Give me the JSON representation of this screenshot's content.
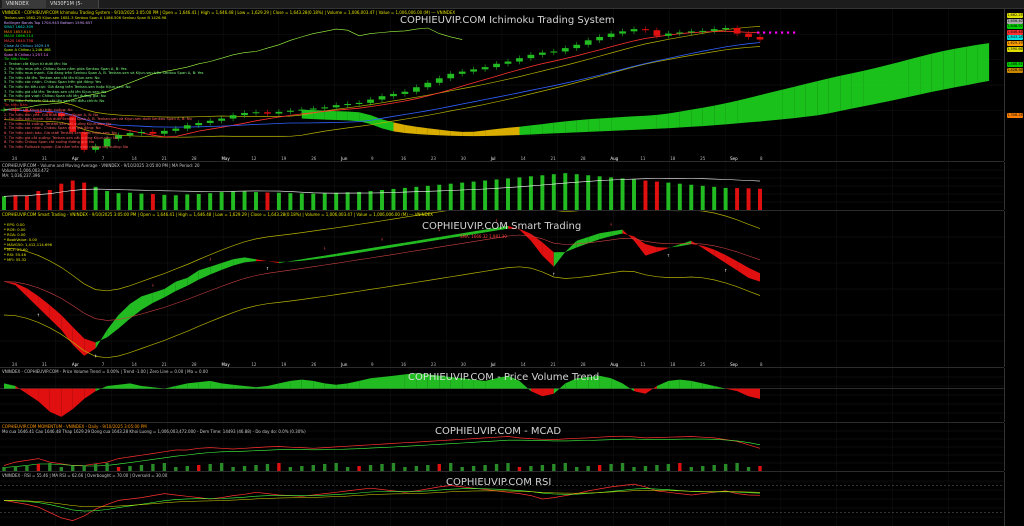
{
  "tabs": [
    "VNINDEX (Daily)",
    "VN30F1M (5-minute)"
  ],
  "panels": {
    "ichimoku": {
      "title": "COPHIEUVIP.COM Ichimoku Trading System",
      "header": "VNINDEX - COPHIEUVIP.COM Ichimoku Trading System - 9/10/2025 3:05:00 PM | Open = 1,646.41 | High = 1,646.48 | Low = 1,629.29 | Close = 1,643.28(0.18%) | Volume = 1,006,003.47 | Value = 1,006,006.00 (M) --- VNINDEX",
      "info_lines": [
        "Tenkan-sen 1662.25  Kijun-sen 1681.3  Senkou Span A 1486.506  Senkou Span B 1426.98",
        "Bollinger Bands Top 1704.943  Bottom 1590.657",
        "SMA7 1662.309",
        "MA5 1653.614",
        "MA10 1666.314",
        "MA20 1640.758",
        "Close At Chikou 1629.19",
        "Span A Chikou 1,246.468",
        "Span B Chikou 1,257.14",
        "Tin hiệu Mua:",
        "1. Tenkan cắt Kijun từ dưới lên: No",
        "2. Tín hiệu mua yếu. Chikou Span nằm giữa Senkou Span A, B: Yes",
        "3. Tín hiệu mua mạnh. Giá đang trên Senkou Span A, B. Tenkan-sen và Kijun-sen trên Senkou Span A, B: Yes",
        "4. Tín hiệu cắt lên. Tenkan-sen cắt lên Kijun-sen: No",
        "5. Tín hiệu xác nhận. Chikou Span trên giá đóng: Yes",
        "6. Tín hiệu tín tiêu cực: Giá đang trên Tenkan-sen hoặc Kijun-sen: No",
        "7. Tín hiệu giá cắt lên: Tenkan-sen cắt lên Kijun-sen: No",
        "8. Tín hiệu giá vượt: Chikou Span cắt lên đường giá: No",
        "9. Tín hiệu Pullback: Giá cắt lên sau khi điều chỉnh: No",
        "Tin hiệu Bán:",
        "1. Tenkan cắt Kijun từ trên xuống: No",
        "2. Tín hiệu bán yếu. Giá dưới Senkou Span A, B: No",
        "3. Tín hiệu bán mạnh. Giá dưới Senkou Span A, B. Tenkan-sen và Kijun-sen dưới Senkou Span A, B: No",
        "4. Tín hiệu cắt xuống. Tenkan-sen cắt xuống Kijun-sen: No",
        "5. Tín hiệu xác nhận. Chikou Span dưới giá đóng: No",
        "6. Tín hiệu cảnh báo. Giá dưới Tenkan-sen hoặc Kijun-sen: No",
        "7. Tín hiệu giá cắt xuống: Tenkan-sen cắt xuống Kijun-sen: No",
        "8. Tín hiệu Chikou Span cắt xuống đường giá: No",
        "9. Tín hiệu Pullback ngược: Giá nằm trên mây nhưng cắt xuống: No"
      ]
    },
    "volume": {
      "header": "COPHIEUVIP.COM - Volume and Moving Average - VNINDEX - 9/10/2025 3:05:00 PM | MA Period: 20",
      "line2": "Volume: 1,006,003.472",
      "line3": "MA: 1,036,237.396"
    },
    "smart": {
      "title": "COPHIEUVIP.COM Smart Trading",
      "header": "COPHIEUVIP.COM Smart Trading - VNINDEX - 9/10/2025 3:05:00 PM | Open = 1,646.41 | High = 1,646.48 | Low = 1,629.29 | Close = 1,643.28(0.18%) | Volume = 1,006,003.47 | Value = 1,006,006.00 (M) --- VNINDEX",
      "info_lines": [
        "* EPS: 0.00",
        "* ROE: 0.00",
        "* ROA: 0.00",
        "* BookValue: 0.00",
        "* MAVG50: 1,412,114.696",
        "* MCF: 23.60",
        "* RSI: 55.46",
        "* MFI: 55.32"
      ],
      "mid_label": "SMA: 1666.32 1,981.30"
    },
    "pvt": {
      "title": "COPHIEUVIP.COM - Price Volume Trend",
      "header": "VNINDEX - COPHIEUVIP.COM - Price Volume Trend = 0.00% | Trend -1.00 | Zero Line = 0.00 | Ma = 0.00"
    },
    "macd": {
      "title": "COPHIEUVIP.COM - MCAD",
      "header": "COPHIEUVIP.COM MOMENTUM - VNINDEX - Daily - 9/10/2025 3:05:00 PM",
      "line2": "Mo cua 1646.41  Cao 1646.48  Thap 1629.29  Dong cua 1643.28  Khoi Luong = 1,006,003,472.000 - Dem Time: 14493 (46.88) - Do day do: 0.0% (0.30%)"
    },
    "rsi": {
      "title": "COPHIEUVIP.COM RSI",
      "header": "VNINDEX - RSI = 55.46 | MA RSI = 62.66 | Overbought = 70.00 | Oversold = 30.00"
    }
  },
  "x_axis_labels": [
    "24",
    "31",
    "Apr",
    "7",
    "14",
    "21",
    "28",
    "May",
    "12",
    "19",
    "26",
    "Jun",
    "9",
    "16",
    "23",
    "30",
    "Jul",
    "14",
    "21",
    "28",
    "Aug",
    "11",
    "18",
    "25",
    "Sep",
    "8"
  ],
  "price_axis_tags": [
    "1,662.25",
    "1,656.40",
    "1,648.92",
    "1,646.48",
    "1,643.28",
    "1,629.29",
    "1,590.66",
    "1,486.51",
    "1,426.98",
    "1,356.28"
  ],
  "chart_data": [
    {
      "type": "candlestick",
      "title": "COPHIEUVIP.COM Ichimoku Trading System",
      "x_start": "2025-03-24",
      "x_end": "2025-09-10",
      "close": [
        1330,
        1325,
        1320,
        1318,
        1315,
        1300,
        1230,
        1150,
        1165,
        1200,
        1215,
        1225,
        1230,
        1222,
        1235,
        1245,
        1260,
        1270,
        1280,
        1290,
        1305,
        1315,
        1318,
        1312,
        1320,
        1325,
        1330,
        1335,
        1340,
        1350,
        1355,
        1360,
        1375,
        1390,
        1400,
        1410,
        1430,
        1450,
        1470,
        1490,
        1500,
        1510,
        1520,
        1535,
        1545,
        1560,
        1575,
        1585,
        1590,
        1605,
        1620,
        1640,
        1655,
        1670,
        1680,
        1690,
        1685,
        1660,
        1670,
        1675,
        1680,
        1682,
        1690,
        1695,
        1670,
        1655,
        1643.28
      ],
      "ylim": [
        1100,
        1780
      ],
      "last": {
        "open": 1646.41,
        "high": 1646.48,
        "low": 1629.29,
        "close": 1643.28,
        "change_pct": 0.18,
        "volume": 1006003.47
      }
    },
    {
      "type": "bar",
      "title": "Volume and Moving Average",
      "values": [
        650,
        700,
        680,
        900,
        950,
        1250,
        1400,
        1300,
        1100,
        900,
        800,
        820,
        780,
        760,
        720,
        700,
        740,
        760,
        800,
        850,
        870,
        880,
        850,
        830,
        820,
        800,
        790,
        780,
        800,
        820,
        840,
        860,
        900,
        950,
        1000,
        1050,
        1100,
        1150,
        1200,
        1250,
        1300,
        1350,
        1400,
        1450,
        1500,
        1550,
        1600,
        1650,
        1700,
        1750,
        1700,
        1650,
        1600,
        1550,
        1500,
        1450,
        1400,
        1350,
        1300,
        1250,
        1200,
        1150,
        1100,
        1050,
        1040,
        1030,
        1006
      ],
      "ma_period": 20
    },
    {
      "type": "area",
      "title": "COPHIEUVIP.COM Smart Trading",
      "values": [
        0.1,
        0.0,
        -0.3,
        -0.6,
        -0.9,
        -1.2,
        -1.6,
        -1.9,
        -1.7,
        -1.2,
        -0.8,
        -0.5,
        -0.3,
        -0.2,
        -0.1,
        0.1,
        0.2,
        0.4,
        0.5,
        0.6,
        0.7,
        0.75,
        0.7,
        0.65,
        0.6,
        0.65,
        0.7,
        0.75,
        0.8,
        0.85,
        0.9,
        0.95,
        1.0,
        1.05,
        1.1,
        1.15,
        1.2,
        1.25,
        1.3,
        1.35,
        1.4,
        1.45,
        1.5,
        1.55,
        1.6,
        1.5,
        1.2,
        0.8,
        0.5,
        0.9,
        1.2,
        1.3,
        1.4,
        1.45,
        1.5,
        1.2,
        0.8,
        0.9,
        1.0,
        1.1,
        1.2,
        1.0,
        0.8,
        0.6,
        0.4,
        0.2,
        0.1
      ],
      "ylim": [
        -2.2,
        2.0
      ]
    },
    {
      "type": "area",
      "title": "COPHIEUVIP.COM - Price Volume Trend",
      "values": [
        0.2,
        0.1,
        -0.2,
        -0.5,
        -0.9,
        -1.1,
        -0.8,
        -0.4,
        -0.1,
        0.1,
        0.15,
        0.2,
        0.1,
        0.05,
        0.0,
        0.1,
        0.2,
        0.25,
        0.3,
        0.2,
        0.15,
        0.1,
        0.05,
        0.1,
        0.2,
        0.3,
        0.35,
        0.3,
        0.2,
        0.15,
        0.2,
        0.3,
        0.4,
        0.45,
        0.5,
        0.55,
        0.6,
        0.55,
        0.5,
        0.45,
        0.4,
        0.35,
        0.3,
        0.4,
        0.5,
        0.3,
        -0.1,
        -0.3,
        -0.2,
        0.2,
        0.4,
        0.45,
        0.5,
        0.4,
        0.2,
        -0.1,
        -0.2,
        0.1,
        0.3,
        0.35,
        0.3,
        0.2,
        0.1,
        0.0,
        -0.1,
        -0.3,
        -0.4
      ],
      "ylim": [
        -1.3,
        0.8
      ]
    },
    {
      "type": "line",
      "title": "COPHIEUVIP.COM - MCAD",
      "values": [
        0.1,
        0.2,
        0.25,
        0.3,
        0.2,
        0.15,
        0.1,
        0.1,
        0.15,
        0.2,
        0.3,
        0.35,
        0.4,
        0.45,
        0.5,
        0.55,
        0.55,
        0.6,
        0.62,
        0.6,
        0.58,
        0.6,
        0.62,
        0.64,
        0.65,
        0.63,
        0.62,
        0.6,
        0.62,
        0.64,
        0.66,
        0.68,
        0.7,
        0.72,
        0.74,
        0.76,
        0.78,
        0.8,
        0.82,
        0.84,
        0.86,
        0.88,
        0.9,
        0.92,
        0.94,
        0.9,
        0.88,
        0.86,
        0.85,
        0.87,
        0.89,
        0.9,
        0.92,
        0.94,
        0.95,
        0.93,
        0.9,
        0.91,
        0.92,
        0.93,
        0.94,
        0.92,
        0.9,
        0.85,
        0.8,
        0.7,
        0.6
      ],
      "ylim": [
        0,
        1.1
      ]
    },
    {
      "type": "line",
      "title": "COPHIEUVIP.COM RSI",
      "values": [
        48,
        45,
        42,
        38,
        30,
        22,
        18,
        25,
        35,
        42,
        48,
        50,
        52,
        55,
        58,
        56,
        54,
        52,
        50,
        52,
        55,
        57,
        60,
        58,
        56,
        55,
        54,
        56,
        58,
        60,
        62,
        64,
        66,
        64,
        62,
        60,
        62,
        65,
        68,
        70,
        68,
        66,
        64,
        62,
        60,
        58,
        55,
        50,
        52,
        55,
        58,
        62,
        65,
        68,
        70,
        72,
        68,
        62,
        60,
        58,
        56,
        58,
        60,
        62,
        58,
        56,
        55.46
      ],
      "ylim": [
        10,
        90
      ],
      "levels": {
        "overbought": 70,
        "oversold": 30
      }
    }
  ],
  "colors": {
    "bull": "#22bb22",
    "bear": "#e01010",
    "cloud_bull": "#1ed61e",
    "cloud_bear": "#f0c000",
    "watermark": "#e8e8e8"
  }
}
